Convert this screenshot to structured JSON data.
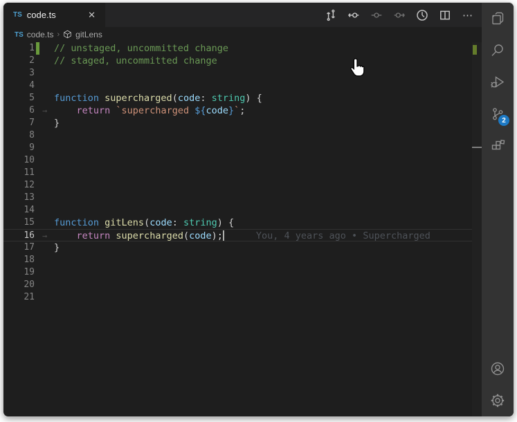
{
  "tab_bar": {
    "tabs": [
      {
        "icon": "TS",
        "label": "code.ts",
        "close_glyph": "✕"
      }
    ]
  },
  "toolbar": {
    "more_glyph": "⋯",
    "icons": [
      {
        "name": "gitlens-compare-icon",
        "dim": false
      },
      {
        "name": "open-previous-change-icon",
        "dim": false
      },
      {
        "name": "open-change-icon",
        "dim": true
      },
      {
        "name": "open-next-change-icon",
        "dim": true
      },
      {
        "name": "file-history-icon",
        "dim": false
      },
      {
        "name": "split-editor-icon",
        "dim": false
      },
      {
        "name": "more-actions-icon",
        "dim": false
      }
    ]
  },
  "breadcrumb": {
    "file_icon": "TS",
    "file": "code.ts",
    "separator": "›",
    "symbol": "gitLens"
  },
  "editor": {
    "blame_annotation": "You, 4 years ago • Supercharged",
    "lines": [
      {
        "n": 1,
        "bar": true,
        "tokens": [
          {
            "c": "cm",
            "t": "// unstaged, uncommitted change"
          }
        ]
      },
      {
        "n": 2,
        "tokens": [
          {
            "c": "cm",
            "t": "// staged, uncommitted change"
          }
        ]
      },
      {
        "n": 3,
        "tokens": []
      },
      {
        "n": 4,
        "tokens": []
      },
      {
        "n": 5,
        "tokens": [
          {
            "c": "kw",
            "t": "function "
          },
          {
            "c": "fn",
            "t": "supercharged"
          },
          {
            "c": "punc",
            "t": "("
          },
          {
            "c": "param",
            "t": "code"
          },
          {
            "c": "punc",
            "t": ": "
          },
          {
            "c": "type",
            "t": "string"
          },
          {
            "c": "punc",
            "t": ") {"
          }
        ]
      },
      {
        "n": 6,
        "tab": true,
        "tokens": [
          {
            "c": "punc",
            "t": "    "
          },
          {
            "c": "ctrl",
            "t": "return "
          },
          {
            "c": "str",
            "t": "`supercharged "
          },
          {
            "c": "interp",
            "t": "${"
          },
          {
            "c": "param",
            "t": "code"
          },
          {
            "c": "interp",
            "t": "}"
          },
          {
            "c": "str",
            "t": "`"
          },
          {
            "c": "punc",
            "t": ";"
          }
        ]
      },
      {
        "n": 7,
        "tokens": [
          {
            "c": "punc",
            "t": "}"
          }
        ]
      },
      {
        "n": 8,
        "tokens": []
      },
      {
        "n": 9,
        "tokens": []
      },
      {
        "n": 10,
        "tokens": []
      },
      {
        "n": 11,
        "tokens": []
      },
      {
        "n": 12,
        "tokens": []
      },
      {
        "n": 13,
        "tokens": []
      },
      {
        "n": 14,
        "tokens": []
      },
      {
        "n": 15,
        "tokens": [
          {
            "c": "kw",
            "t": "function "
          },
          {
            "c": "fn",
            "t": "gitLens"
          },
          {
            "c": "punc",
            "t": "("
          },
          {
            "c": "param",
            "t": "code"
          },
          {
            "c": "punc",
            "t": ": "
          },
          {
            "c": "type",
            "t": "string"
          },
          {
            "c": "punc",
            "t": ") {"
          }
        ]
      },
      {
        "n": 16,
        "tab": true,
        "current": true,
        "cursor": true,
        "blame": true,
        "tokens": [
          {
            "c": "punc",
            "t": "    "
          },
          {
            "c": "ctrl",
            "t": "return "
          },
          {
            "c": "fn",
            "t": "supercharged"
          },
          {
            "c": "punc",
            "t": "("
          },
          {
            "c": "param",
            "t": "code"
          },
          {
            "c": "punc",
            "t": ");"
          }
        ]
      },
      {
        "n": 17,
        "tokens": [
          {
            "c": "punc",
            "t": "}"
          }
        ]
      },
      {
        "n": 18,
        "tokens": []
      },
      {
        "n": 19,
        "tokens": []
      },
      {
        "n": 20,
        "tokens": []
      },
      {
        "n": 21,
        "tokens": []
      }
    ]
  },
  "activity_bar": {
    "items": [
      {
        "name": "explorer"
      },
      {
        "name": "search"
      },
      {
        "name": "run-and-debug"
      },
      {
        "name": "source-control",
        "badge": "2"
      },
      {
        "name": "extensions"
      },
      {
        "name": "accounts"
      },
      {
        "name": "settings"
      }
    ],
    "scm_badge": "2"
  },
  "colors": {
    "editor_bg": "#1e1e1e",
    "tabbar_bg": "#252526",
    "activitybar_bg": "#333333",
    "badge_bg": "#1d79c4",
    "gutter_added": "#6a9a3c",
    "comment": "#6a9955",
    "keyword": "#569cd6",
    "control": "#c586c0",
    "function": "#dcdcaa",
    "parameter": "#9cdcfe",
    "type": "#4ec9b0",
    "string": "#ce9178",
    "blame": "#4e5258"
  }
}
